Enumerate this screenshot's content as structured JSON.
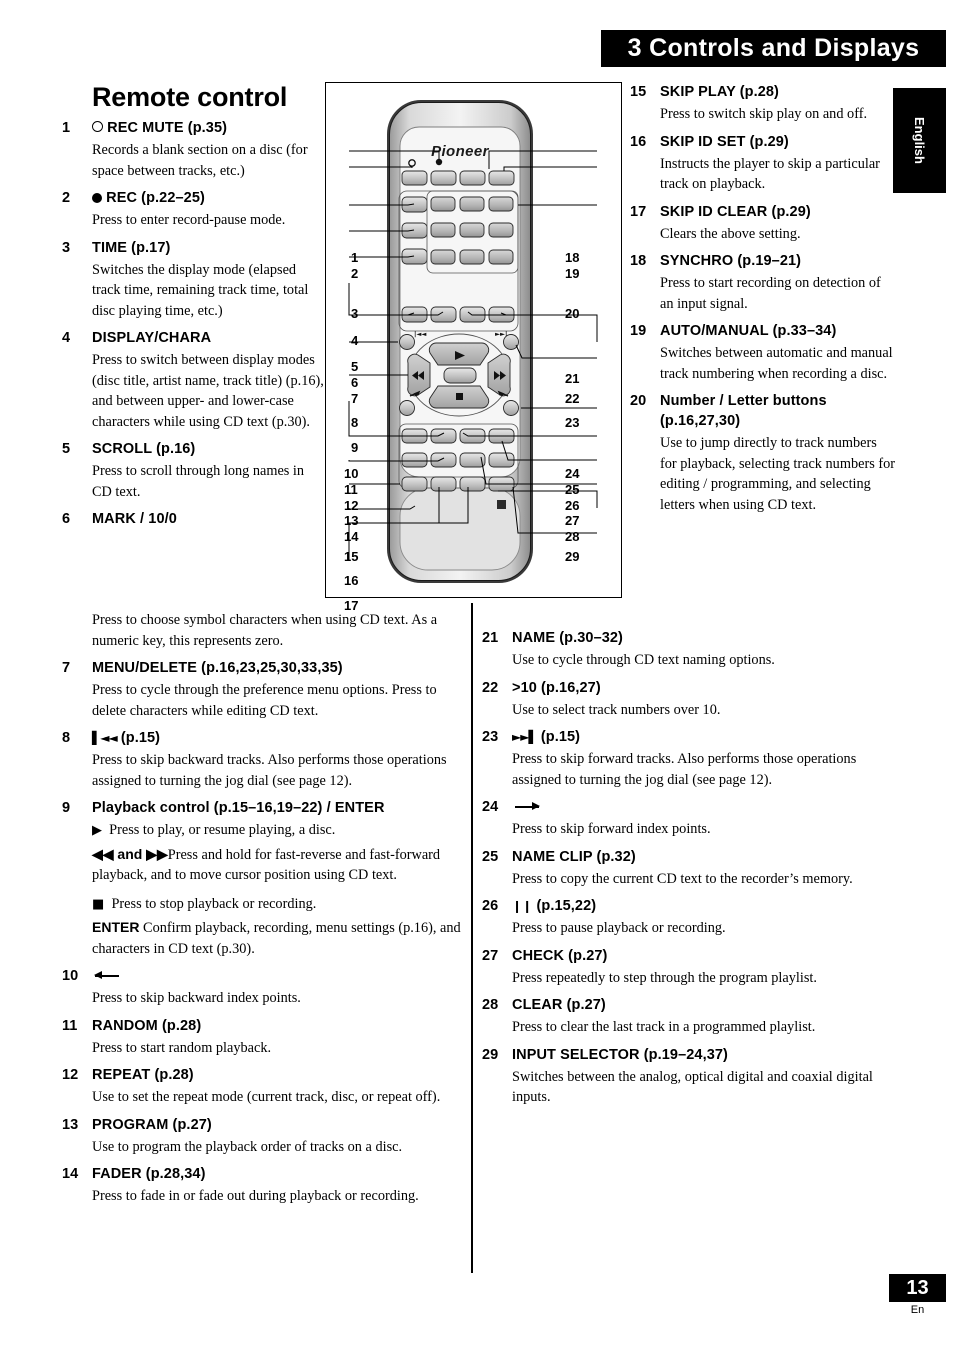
{
  "header": {
    "chapter_title": "3 Controls and Displays",
    "language_tab": "English"
  },
  "footer": {
    "page_number": "13",
    "language_code": "En"
  },
  "section": {
    "title": "Remote control"
  },
  "figure": {
    "brand": "Pioneer",
    "left_callouts": [
      "1",
      "2",
      "3",
      "4",
      "5",
      "6",
      "7",
      "8",
      "9",
      "10",
      "11",
      "12",
      "13",
      "14",
      "15",
      "16",
      "17"
    ],
    "right_callouts": [
      "18",
      "19",
      "20",
      "21",
      "22",
      "23",
      "24",
      "25",
      "26",
      "27",
      "28",
      "29"
    ],
    "button_labels": {
      "skip_back": "|◀◀",
      "skip_fwd": "▶▶|"
    }
  },
  "items": [
    {
      "num": "1",
      "icon": "open-circle-rec-mute-icon",
      "title": " REC MUTE (p.35)",
      "desc": "Records a blank section on a disc (for space between tracks, etc.)"
    },
    {
      "num": "2",
      "icon": "filled-circle-rec-icon",
      "title": " REC  (p.22–25)",
      "desc": "Press to enter record-pause mode."
    },
    {
      "num": "3",
      "title": "TIME  (p.17)",
      "desc": "Switches the display mode (elapsed track time, remaining track time, total disc playing time, etc.)"
    },
    {
      "num": "4",
      "title": "DISPLAY/CHARA",
      "desc": "Press to switch between display modes (disc title, artist name, track title) (p.16), and between upper- and lower-case characters while using CD text (p.30)."
    },
    {
      "num": "5",
      "title": "SCROLL (p.16)",
      "desc": "Press to scroll through long names in CD text."
    },
    {
      "num": "6",
      "title": "MARK / 10/0",
      "desc": "Press to choose symbol characters when using CD text. As a numeric key, this represents zero."
    },
    {
      "num": "7",
      "title": "MENU/DELETE (p.16,23,25,30,33,35)",
      "desc": "Press to cycle through the preference menu options. Press to delete characters while editing CD text."
    },
    {
      "num": "8",
      "icon": "skip-backward-icon",
      "title": " (p.15)",
      "desc": "Press to skip backward tracks. Also performs those operations assigned to turning the jog dial (see page 12)."
    },
    {
      "num": "9",
      "title": "Playback control (p.15–16,19–22) / ENTER",
      "lines": [
        {
          "icon": "play-icon",
          "text": "Press to play, or resume playing, a disc."
        },
        {
          "icon": "rew-ff-icon",
          "bold": "◀◀ and ▶▶",
          "text": "Press and hold for fast-reverse and fast-forward playback, and to move cursor position using CD text."
        },
        {
          "icon": "stop-icon",
          "text": "Press to stop playback or recording."
        },
        {
          "bold": "ENTER",
          "text": " Confirm playback, recording, menu settings (p.16), and characters in CD text (p.30)."
        }
      ]
    },
    {
      "num": "10",
      "icon": "arrow-left-index-icon",
      "title": "",
      "desc": "Press to skip backward index points."
    },
    {
      "num": "11",
      "title": "RANDOM  (p.28)",
      "desc": "Press to start random playback."
    },
    {
      "num": "12",
      "title": "REPEAT  (p.28)",
      "desc": "Use to set the repeat mode (current track, disc, or repeat off)."
    },
    {
      "num": "13",
      "title": "PROGRAM  (p.27)",
      "desc": "Use to program the playback order of tracks on a disc."
    },
    {
      "num": "14",
      "title": "FADER  (p.28,34)",
      "desc": "Press to fade in or fade out during playback or recording."
    },
    {
      "num": "15",
      "title": "SKIP PLAY (p.28)",
      "desc": "Press to switch skip play on and off."
    },
    {
      "num": "16",
      "title": "SKIP ID SET (p.29)",
      "desc": "Instructs the player to skip a particular track on playback."
    },
    {
      "num": "17",
      "title": "SKIP ID CLEAR (p.29)",
      "desc": "Clears the above setting."
    },
    {
      "num": "18",
      "title": "SYNCHRO (p.19–21)",
      "desc": "Press to start recording on detection of an input signal."
    },
    {
      "num": "19",
      "title": "AUTO/MANUAL (p.33–34)",
      "desc": "Switches between automatic and manual track numbering when recording a disc."
    },
    {
      "num": "20",
      "title": "Number / Letter buttons (p.16,27,30)",
      "desc": "Use to jump directly to track numbers for playback, selecting track numbers for editing / programming, and selecting letters when using CD text."
    },
    {
      "num": "21",
      "title": "NAME (p.30–32)",
      "desc": "Use to cycle through CD text naming options."
    },
    {
      "num": "22",
      "title": ">10 (p.16,27)",
      "desc": "Use to select track numbers over 10."
    },
    {
      "num": "23",
      "icon": "skip-forward-icon",
      "title": " (p.15)",
      "desc": "Press to skip forward tracks. Also performs those operations assigned to turning the jog dial (see page 12)."
    },
    {
      "num": "24",
      "icon": "arrow-right-index-icon",
      "title": "",
      "desc": "Press to skip forward index points."
    },
    {
      "num": "25",
      "title": "NAME CLIP (p.32)",
      "desc": "Press to copy the current CD text to the recorder’s memory."
    },
    {
      "num": "26",
      "icon": "pause-icon",
      "title": " (p.15,22)",
      "desc": "Press to pause playback or recording."
    },
    {
      "num": "27",
      "title": "CHECK  (p.27)",
      "desc": "Press repeatedly to step through the program playlist."
    },
    {
      "num": "28",
      "title": "CLEAR  (p.27)",
      "desc": "Press to clear the last track in a programmed playlist."
    },
    {
      "num": "29",
      "title": "INPUT SELECTOR  (p.19–24,37)",
      "desc": "Switches between the analog, optical digital and coaxial digital inputs."
    }
  ]
}
